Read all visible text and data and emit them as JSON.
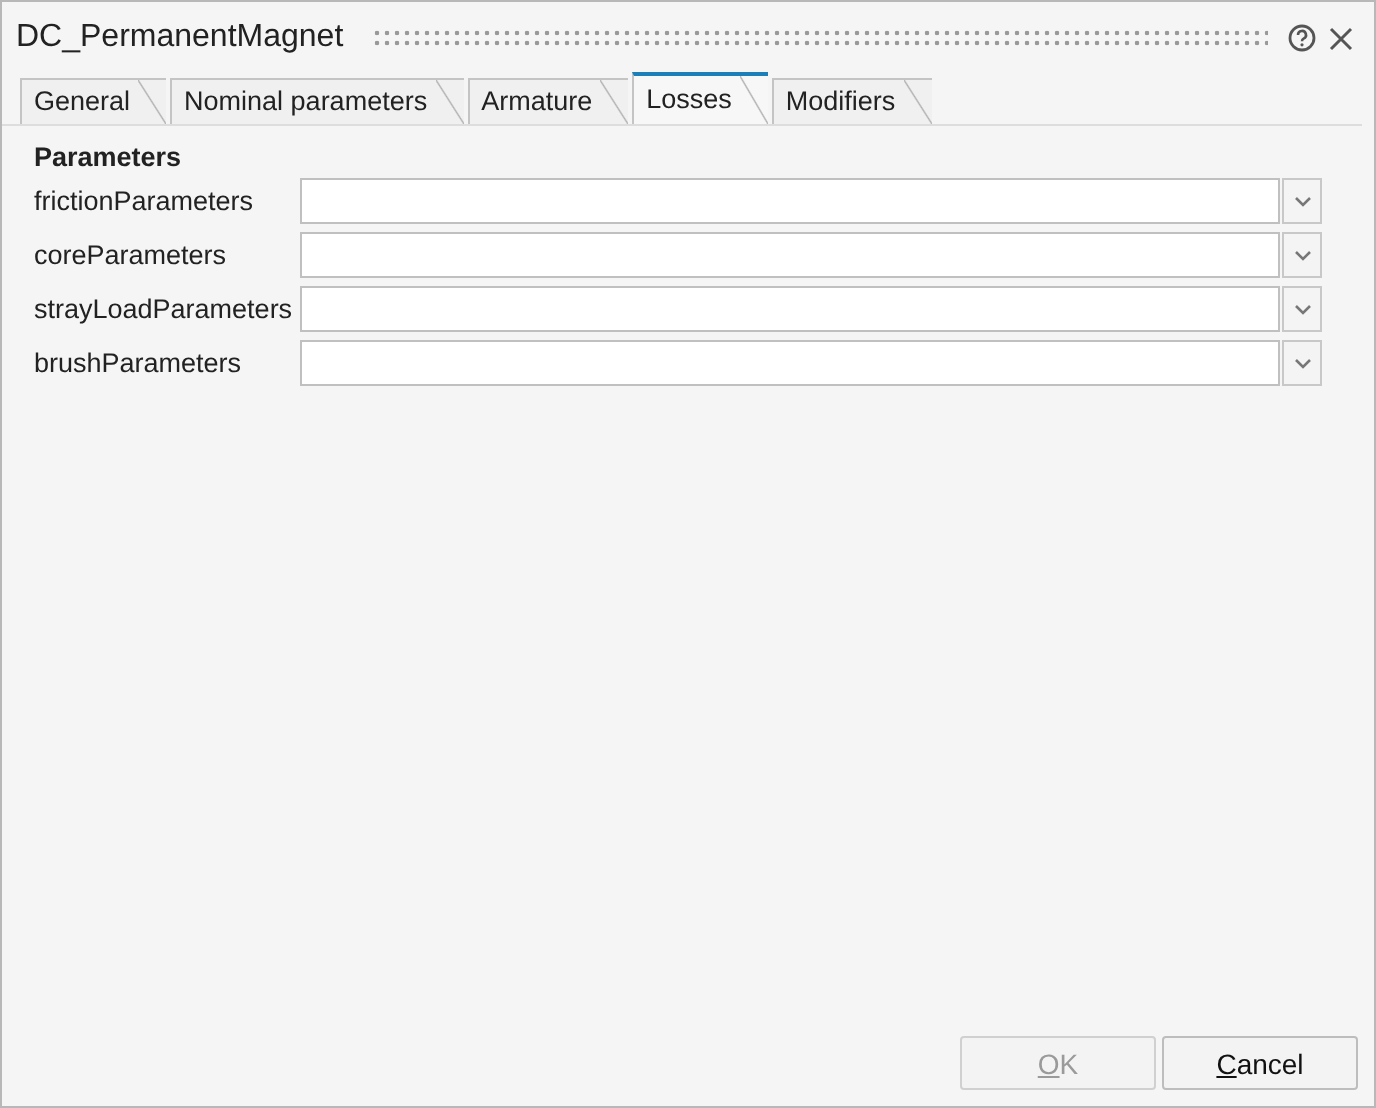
{
  "window": {
    "title": "DC_PermanentMagnet"
  },
  "tabs": [
    {
      "label": "General",
      "selected": false
    },
    {
      "label": "Nominal parameters",
      "selected": false
    },
    {
      "label": "Armature",
      "selected": false
    },
    {
      "label": "Losses",
      "selected": true
    },
    {
      "label": "Modifiers",
      "selected": false
    }
  ],
  "section": {
    "title": "Parameters"
  },
  "fields": [
    {
      "label": "frictionParameters"
    },
    {
      "label": "coreParameters"
    },
    {
      "label": "strayLoadParameters"
    },
    {
      "label": "brushParameters"
    }
  ],
  "buttons": [
    {
      "label": "OK",
      "disabled": true
    },
    {
      "label": "Cancel",
      "disabled": false
    }
  ]
}
